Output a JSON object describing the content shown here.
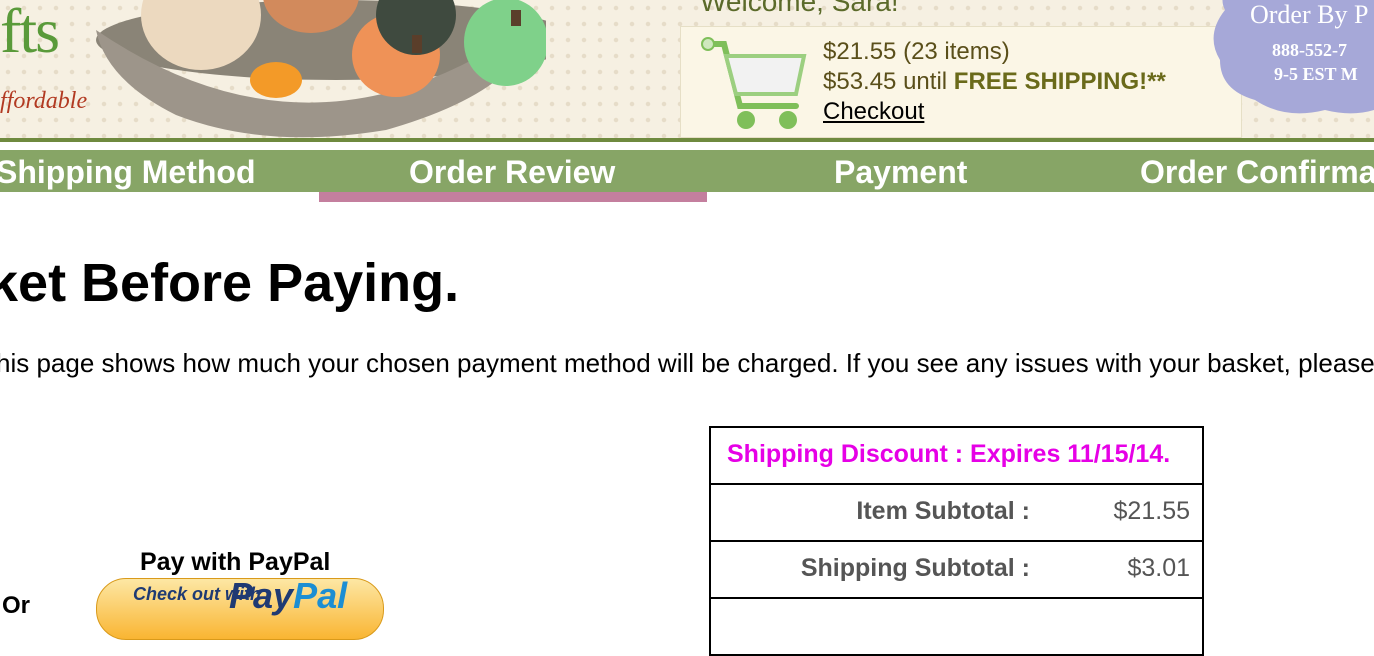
{
  "header": {
    "logo_fts": "fts",
    "logo_tagline": "ffordable",
    "welcome": "Welcome, Sara!",
    "cart": {
      "summary": "$21.55 (23 items)",
      "until_amount": "$53.45 until",
      "free_shipping": "FREE SHIPPING!**",
      "checkout_label": "Checkout"
    },
    "badge": {
      "line1": "Order By P",
      "line2": "888-552-7",
      "line3": "9-5 EST M"
    }
  },
  "steps": [
    {
      "label": "Shipping Method"
    },
    {
      "label": "Order Review",
      "active": true
    },
    {
      "label": "Payment"
    },
    {
      "label": "Order Confirma"
    }
  ],
  "main": {
    "heading": "ket Before Paying.",
    "intro": "his page shows how much your chosen payment method will be charged. If you see any issues with your basket, please",
    "paypal_label": "Pay with PayPal",
    "paypal_button": {
      "small_text": "Check out with",
      "brand_pay": "Pay",
      "brand_pal": "Pal"
    },
    "or_label": "Or"
  },
  "totals": {
    "discount": "Shipping Discount : Expires 11/15/14.",
    "rows": [
      {
        "label": "Item Subtotal :",
        "value": "$21.55"
      },
      {
        "label": "Shipping Subtotal :",
        "value": "$3.01"
      }
    ]
  },
  "colors": {
    "nav_green": "#87a566",
    "active_step_indicator": "#c47f9e",
    "discount_magenta": "#e600e6"
  }
}
